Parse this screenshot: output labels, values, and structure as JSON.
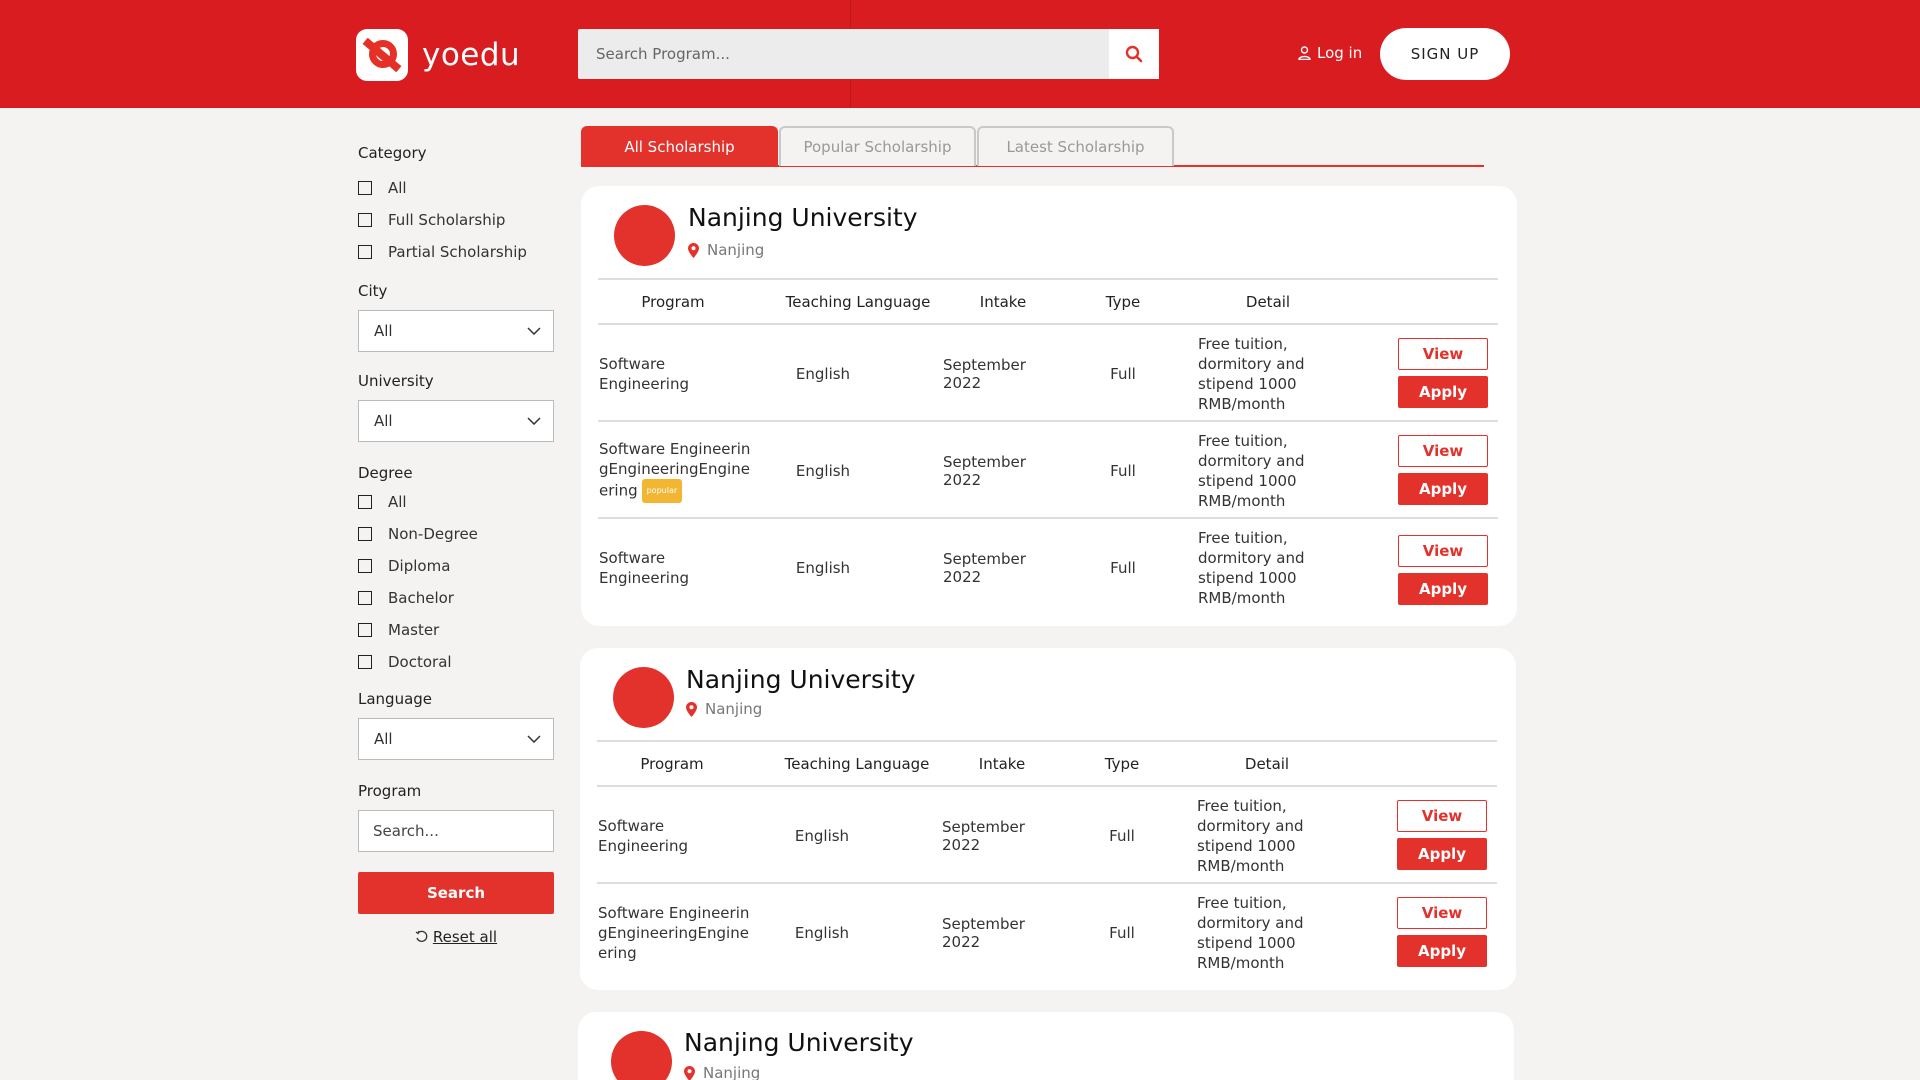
{
  "header": {
    "brand": "yoedu",
    "search_placeholder": "Search Program...",
    "login_label": "Log in",
    "signup_label": "SIGN UP"
  },
  "sidebar": {
    "category_title": "Category",
    "category_items": [
      "All",
      "Full Scholarship",
      "Partial Scholarship"
    ],
    "city_title": "City",
    "city_value": "All",
    "university_title": "University",
    "university_value": "All",
    "degree_title": "Degree",
    "degree_items": [
      "All",
      "Non-Degree",
      "Diploma",
      "Bachelor",
      "Master",
      "Doctoral"
    ],
    "language_title": "Language",
    "language_value": "All",
    "program_title": "Program",
    "program_placeholder": "Search...",
    "search_label": "Search",
    "reset_label": "Reset all"
  },
  "tabs": [
    "All Scholarship",
    "Popular Scholarship",
    "Latest Scholarship"
  ],
  "table_headers": [
    "Program",
    "Teaching Language",
    "Intake",
    "Type",
    "Detail"
  ],
  "buttons": {
    "view": "View",
    "apply": "Apply"
  },
  "popular_badge": "popular",
  "cards": [
    {
      "name": "Nanjing University",
      "location": "Nanjing",
      "rows": [
        {
          "program": "Software Engineering",
          "language": "English",
          "intake": "September 2022",
          "type": "Full",
          "detail": "Free tuition, dormitory and stipend 1000 RMB/month"
        },
        {
          "program": "Software EngineeringEngineeringEngineering",
          "language": "English",
          "intake": "September 2022",
          "type": "Full",
          "detail": "Free tuition, dormitory and stipend 1000 RMB/month"
        },
        {
          "program": "Software Engineering",
          "language": "English",
          "intake": "September 2022",
          "type": "Full",
          "detail": "Free tuition, dormitory and stipend 1000 RMB/month"
        }
      ]
    },
    {
      "name": "Nanjing University",
      "location": "Nanjing",
      "rows": [
        {
          "program": "Software Engineering",
          "language": "English",
          "intake": "September 2022",
          "type": "Full",
          "detail": "Free tuition, dormitory and stipend 1000 RMB/month"
        },
        {
          "program": "Software EngineeringEngineeringEngineering",
          "language": "English",
          "intake": "September 2022",
          "type": "Full",
          "detail": "Free tuition, dormitory and stipend 1000 RMB/month"
        }
      ]
    },
    {
      "name": "Nanjing University",
      "location": "Nanjing",
      "rows": []
    }
  ],
  "colors": {
    "brand_red": "#d91c20",
    "accent_red": "#e3312b",
    "badge_yellow": "#f2b632"
  }
}
